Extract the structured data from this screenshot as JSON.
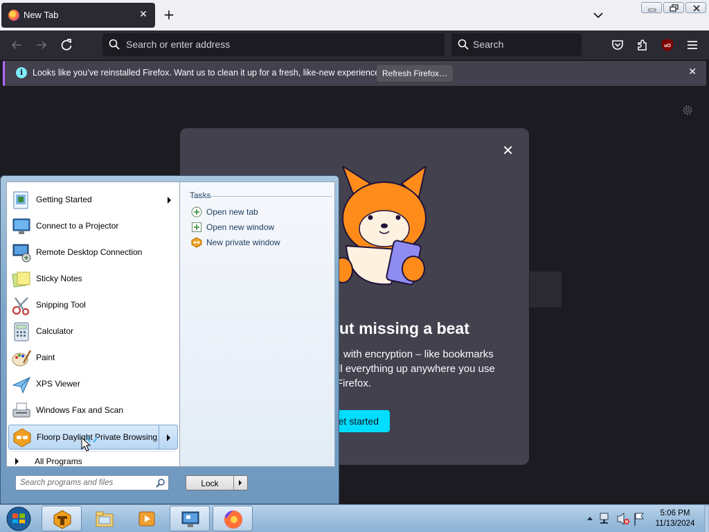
{
  "browser": {
    "tab_title": "New Tab",
    "new_tab": "+",
    "url_placeholder": "Search or enter address",
    "search_placeholder": "Search",
    "notification": {
      "message": "Looks like you’ve reinstalled Firefox. Want us to clean it up for a fresh, like-new experience?",
      "button": "Refresh Firefox…",
      "info_glyph": "i",
      "close_glyph": "✕"
    },
    "modal": {
      "heading": "ut missing a beat",
      "body_lines": [
        "with encryption – like bookmarks",
        "ll everything up anywhere you use",
        "Firefox."
      ],
      "cta": "et started",
      "close_glyph": "✕"
    },
    "colors": {
      "chrome": "#2b2a33",
      "page": "#1c1b22",
      "accent": "#00ddff",
      "notif_border": "#b367ff"
    }
  },
  "start_menu": {
    "programs": [
      {
        "label": "Getting Started",
        "icon": "getting-started-icon",
        "submenu": true
      },
      {
        "label": "Connect to a Projector",
        "icon": "projector-icon",
        "submenu": false
      },
      {
        "label": "Remote Desktop Connection",
        "icon": "remote-desktop-icon",
        "submenu": false
      },
      {
        "label": "Sticky Notes",
        "icon": "sticky-notes-icon",
        "submenu": false
      },
      {
        "label": "Snipping Tool",
        "icon": "scissors-icon",
        "submenu": false
      },
      {
        "label": "Calculator",
        "icon": "calculator-icon",
        "submenu": false
      },
      {
        "label": "Paint",
        "icon": "paint-icon",
        "submenu": false
      },
      {
        "label": "XPS Viewer",
        "icon": "xps-viewer-icon",
        "submenu": false
      },
      {
        "label": "Windows Fax and Scan",
        "icon": "fax-scanner-icon",
        "submenu": false
      },
      {
        "label": "Floorp Daylight Private Browsing",
        "icon": "floorp-private-icon",
        "submenu": true,
        "highlighted": true
      }
    ],
    "all_programs": "All Programs",
    "tasks_heading": "Tasks",
    "tasks": [
      {
        "label": "Open new tab",
        "icon": "new-tab-icon"
      },
      {
        "label": "Open new window",
        "icon": "new-window-icon"
      },
      {
        "label": "New private window",
        "icon": "private-window-icon"
      }
    ],
    "search_placeholder": "Search programs and files",
    "power_button": "Lock"
  },
  "taskbar": {
    "clock_time": "5:06 PM",
    "clock_date": "11/13/2024",
    "pinned": [
      "floorp-icon",
      "file-explorer-icon",
      "media-player-icon",
      "remote-desktop-icon",
      "firefox-icon"
    ]
  }
}
